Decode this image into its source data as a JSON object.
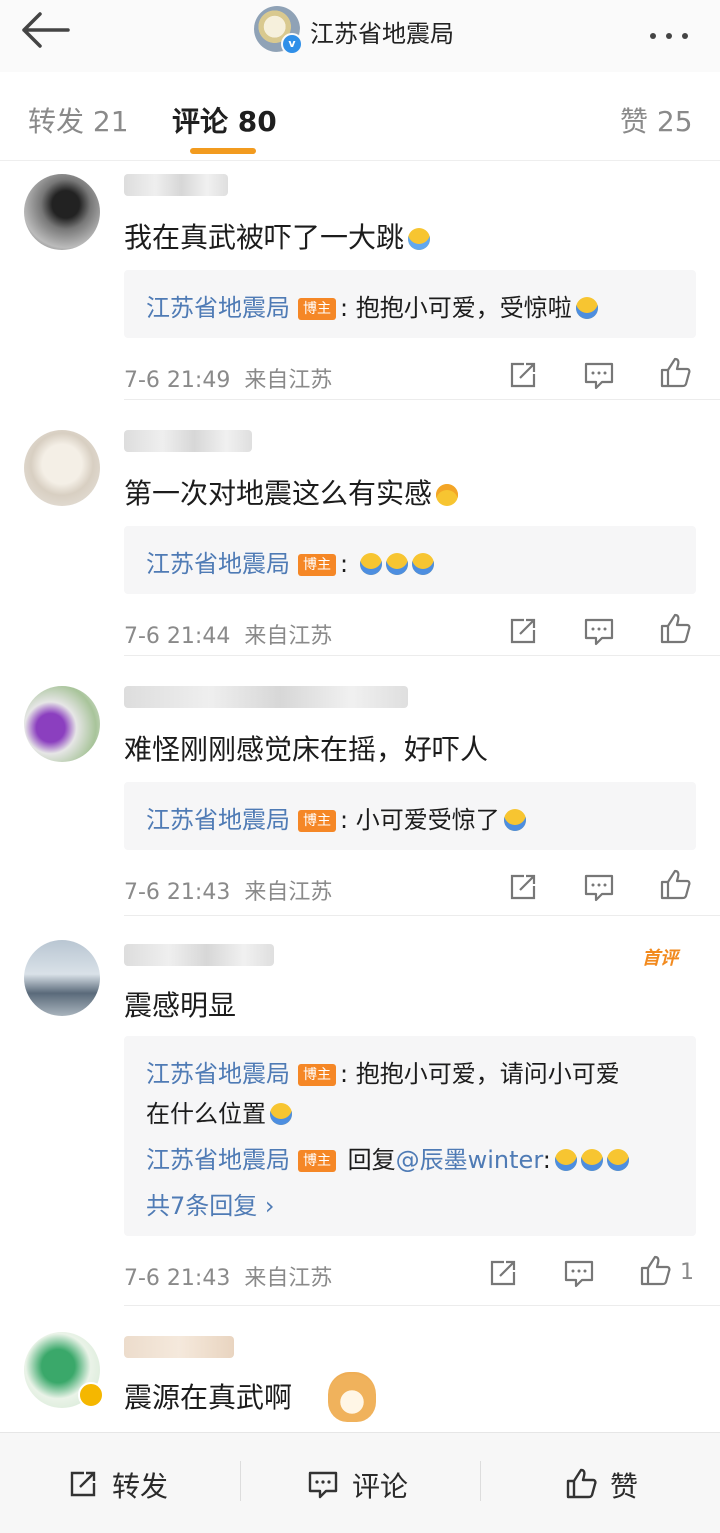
{
  "header": {
    "title": "江苏省地震局",
    "verified_icon": "verified-icon"
  },
  "tabs": {
    "repost": "转发 21",
    "comments": "评论 80",
    "likes": "赞 25"
  },
  "comments": [
    {
      "text": "我在真武被吓了一大跳",
      "emoji": "crying-emoji",
      "replies": [
        {
          "author": "江苏省地震局",
          "badge": "博主",
          "sep": ":",
          "text": " 抱抱小可爱，受惊啦"
        }
      ],
      "time": "7-6 21:49",
      "location": "来自江苏"
    },
    {
      "text": "第一次对地震这么有实感",
      "emoji": "laughing-emoji",
      "replies": [
        {
          "author": "江苏省地震局",
          "badge": "博主",
          "sep": ":",
          "text": " "
        }
      ],
      "time": "7-6 21:44",
      "location": "来自江苏"
    },
    {
      "text": "难怪刚刚感觉床在摇，好吓人",
      "replies": [
        {
          "author": "江苏省地震局",
          "badge": "博主",
          "sep": ":",
          "text": " 小可爱受惊了"
        }
      ],
      "time": "7-6 21:43",
      "location": "来自江苏"
    },
    {
      "text": "震感明显",
      "first_badge": "首评",
      "replies": [
        {
          "author": "江苏省地震局",
          "badge": "博主",
          "sep": ":",
          "text": " 抱抱小可爱，请问小可爱",
          "text2": "在什么位置"
        },
        {
          "author": "江苏省地震局",
          "badge": "博主",
          "text": " 回复",
          "mention": "@辰墨winter",
          "sep": ":"
        }
      ],
      "more_replies": "共7条回复 ›",
      "time": "7-6 21:43",
      "location": "来自江苏",
      "like_count": "1"
    },
    {
      "text": "震源在真武啊"
    }
  ],
  "bottom_bar": {
    "repost": "转发",
    "comment": "评论",
    "like": "赞"
  },
  "colors": {
    "accent": "#f29b1f",
    "link": "#4f7bb5",
    "badge": "#f58726"
  }
}
